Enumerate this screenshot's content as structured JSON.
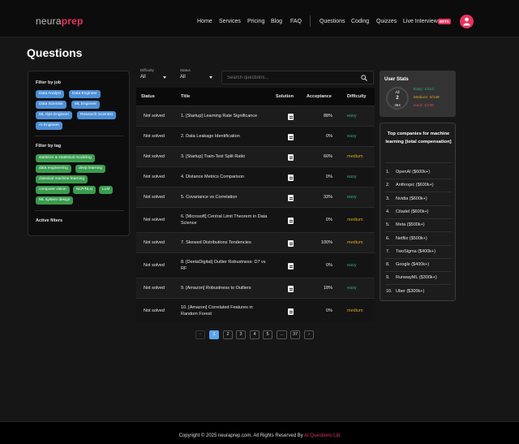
{
  "header": {
    "logo_part1": "neura",
    "logo_part2": "prep",
    "nav": [
      "Home",
      "Services",
      "Pricing",
      "Blog",
      "FAQ"
    ],
    "nav2": [
      "Questions",
      "Coding",
      "Quizzes",
      "Live Interview"
    ],
    "beta_badge": "BETA",
    "avatar_icon": "user-icon",
    "accent": "#e8335f"
  },
  "page_title": "Questions",
  "filters": {
    "by_job_heading": "Filter by job",
    "jobs": [
      "Data Analyst",
      "Data Engineer",
      "Data Scientist",
      "ML Engineer",
      "ML Ops Engineer",
      "Research Scientist",
      "AI Engineer"
    ],
    "by_tag_heading": "Filter by tag",
    "tags": [
      "statistics & statistical modeling",
      "data engineering",
      "deep learning",
      "classical machine learning",
      "computer vision",
      "NLP/NLU",
      "LLM",
      "ML system design"
    ],
    "active_heading": "Active filters"
  },
  "toolbar": {
    "difficulty_label": "Difficulty",
    "difficulty_value": "All",
    "status_label": "Status",
    "status_value": "All",
    "search_placeholder": "Search questions..."
  },
  "table": {
    "headers": {
      "status": "Status",
      "title": "Title",
      "solution": "Solution",
      "acceptance": "Acceptance",
      "difficulty": "Difficulty"
    },
    "rows": [
      {
        "status": "Not solved",
        "title": "1. [Startup] Learning Rate Significance",
        "acceptance": "88%",
        "difficulty": "easy"
      },
      {
        "status": "Not solved",
        "title": "2. Data Leakage Identification",
        "acceptance": "0%",
        "difficulty": "easy"
      },
      {
        "status": "Not solved",
        "title": "3. [Startup] Train-Test Split Ratio",
        "acceptance": "60%",
        "difficulty": "medium"
      },
      {
        "status": "Not solved",
        "title": "4. Distance Metrics Comparison",
        "acceptance": "0%",
        "difficulty": "easy"
      },
      {
        "status": "Not solved",
        "title": "5. Covariance vs Correlation",
        "acceptance": "33%",
        "difficulty": "easy"
      },
      {
        "status": "Not solved",
        "title": "6. [Microsoft] Central Limit Theorem in Data Science",
        "acceptance": "0%",
        "difficulty": "medium"
      },
      {
        "status": "Not solved",
        "title": "7. Skewed Distributions Tendencies",
        "acceptance": "100%",
        "difficulty": "medium"
      },
      {
        "status": "Not solved",
        "title": "8. [DeetaDigital] Outlier Robustness: D7 vs RF",
        "acceptance": "0%",
        "difficulty": "easy"
      },
      {
        "status": "Not solved",
        "title": "9. [Amazon] Robustness to Outliers",
        "acceptance": "18%",
        "difficulty": "easy"
      },
      {
        "status": "Not solved",
        "title": "10. [Amazon] Correlated Features in Random Forest",
        "acceptance": "0%",
        "difficulty": "medium"
      }
    ]
  },
  "pagination": {
    "prev": "‹",
    "pages": [
      "1",
      "2",
      "3",
      "4",
      "5",
      "...",
      "37"
    ],
    "next": "›",
    "current": "1"
  },
  "user_stats": {
    "title": "User Stats",
    "donut_label": "All",
    "solved": "2",
    "total": "364",
    "easy": "Easy: 1/113",
    "medium": "Medium: 0/148",
    "hard": "Hard: 1/100",
    "colors": {
      "easy": "#33b06a",
      "medium": "#e0a21a",
      "hard": "#e24a4a"
    }
  },
  "companies": {
    "title": "Top companies for machine learning [total compensation]",
    "items": [
      "OpenAI ($600k+)",
      "Anthropic ($600k+)",
      "Nvidia ($600k+)",
      "Citadel ($600k+)",
      "Meta ($500k+)",
      "Netflix ($500k+)",
      "TwoSigma ($400k+)",
      "Google ($400k+)",
      "RunwayML ($300k+)",
      "Uber ($300k+)"
    ]
  },
  "footer": {
    "text": "Copyright © 2025 neuraprep.com. All Rights Reserved By ",
    "brand": "AI Questions Ltd"
  }
}
